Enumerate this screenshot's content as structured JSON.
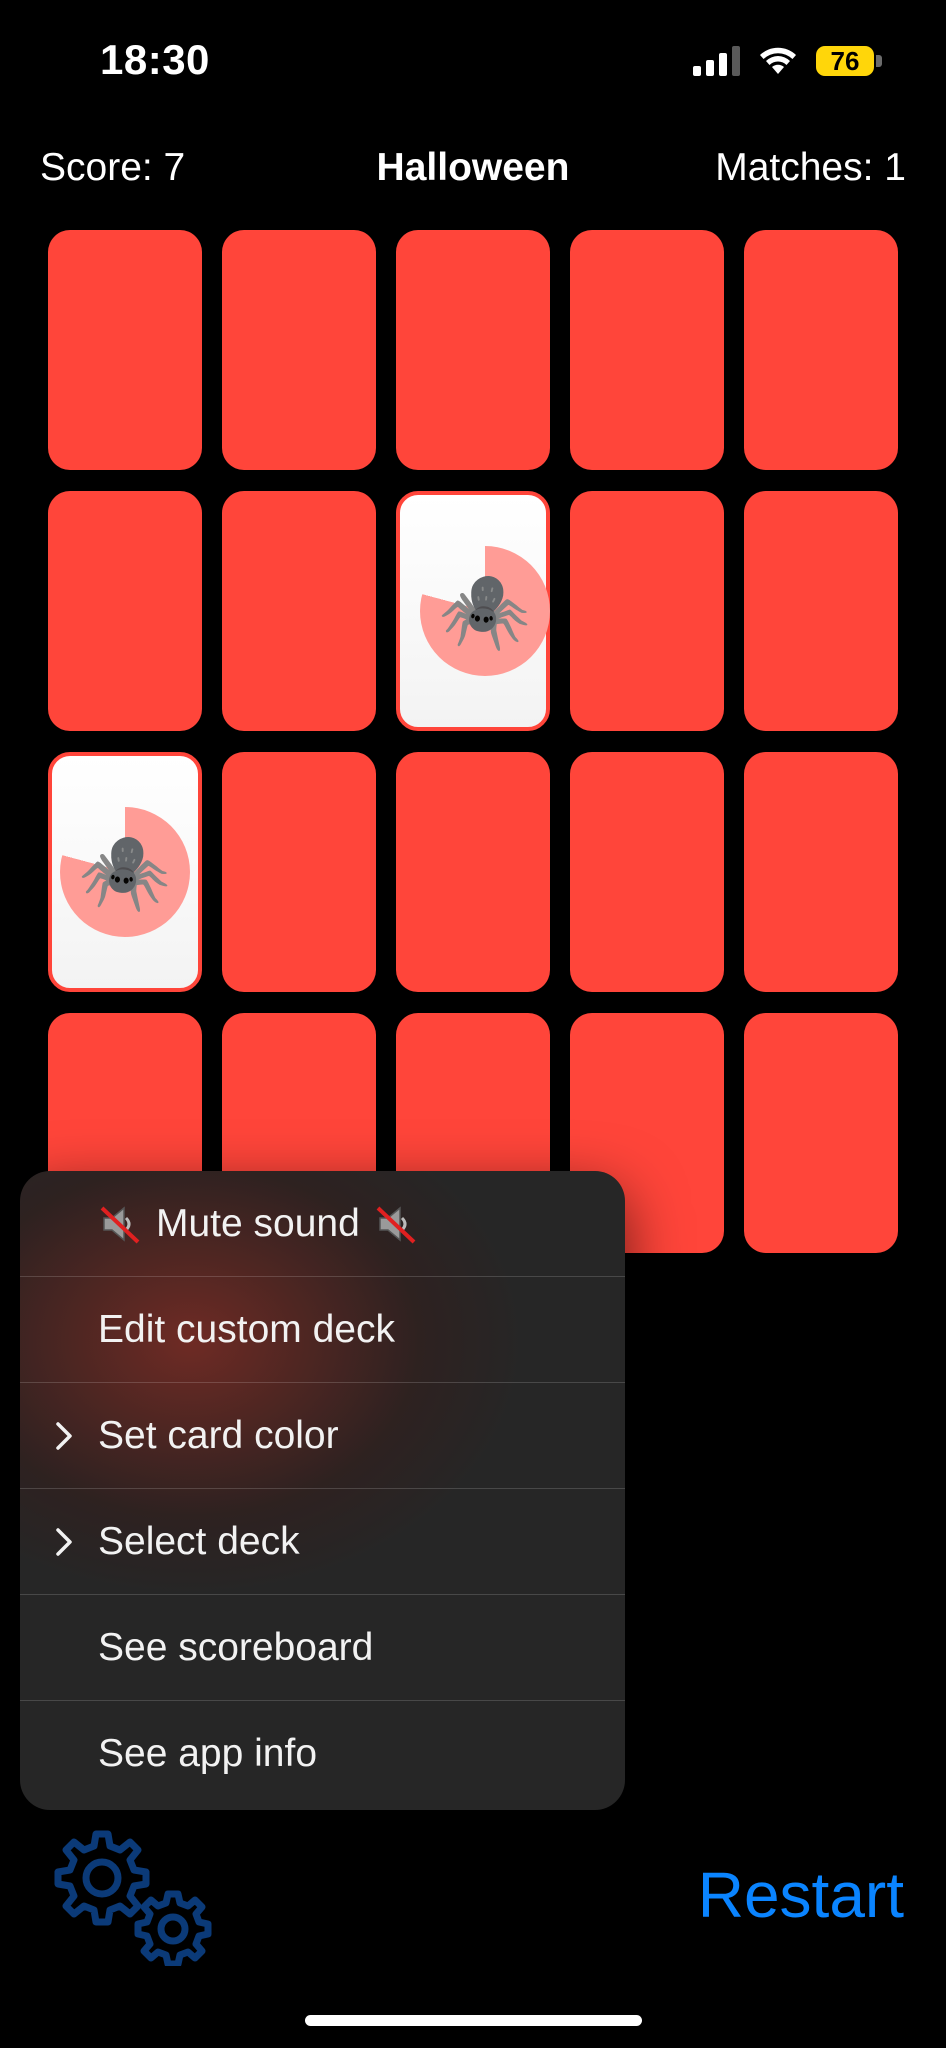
{
  "status_bar": {
    "time": "18:30",
    "battery": "76"
  },
  "header": {
    "score": "Score: 7",
    "title": "Halloween",
    "matches": "Matches: 1"
  },
  "cards": {
    "rows": 4,
    "columns": 5,
    "back_color": "#ff453a",
    "revealed": [
      {
        "row": 2,
        "column": 3,
        "emoji": "🕷️",
        "icon": "spider-icon"
      },
      {
        "row": 3,
        "column": 1,
        "emoji": "🕷️",
        "icon": "spider-icon"
      }
    ]
  },
  "menu": {
    "items": [
      {
        "label": "Mute sound",
        "icon": "mute-speaker-icon"
      },
      {
        "label": "Edit custom deck"
      },
      {
        "label": "Set card color",
        "icon": "chevron-right-icon"
      },
      {
        "label": "Select deck",
        "icon": "chevron-right-icon"
      },
      {
        "label": "See scoreboard"
      },
      {
        "label": "See app info"
      }
    ]
  },
  "toolbar": {
    "settings_icon": "gears-icon",
    "restart_label": "Restart",
    "accent": "#0a84ff"
  }
}
